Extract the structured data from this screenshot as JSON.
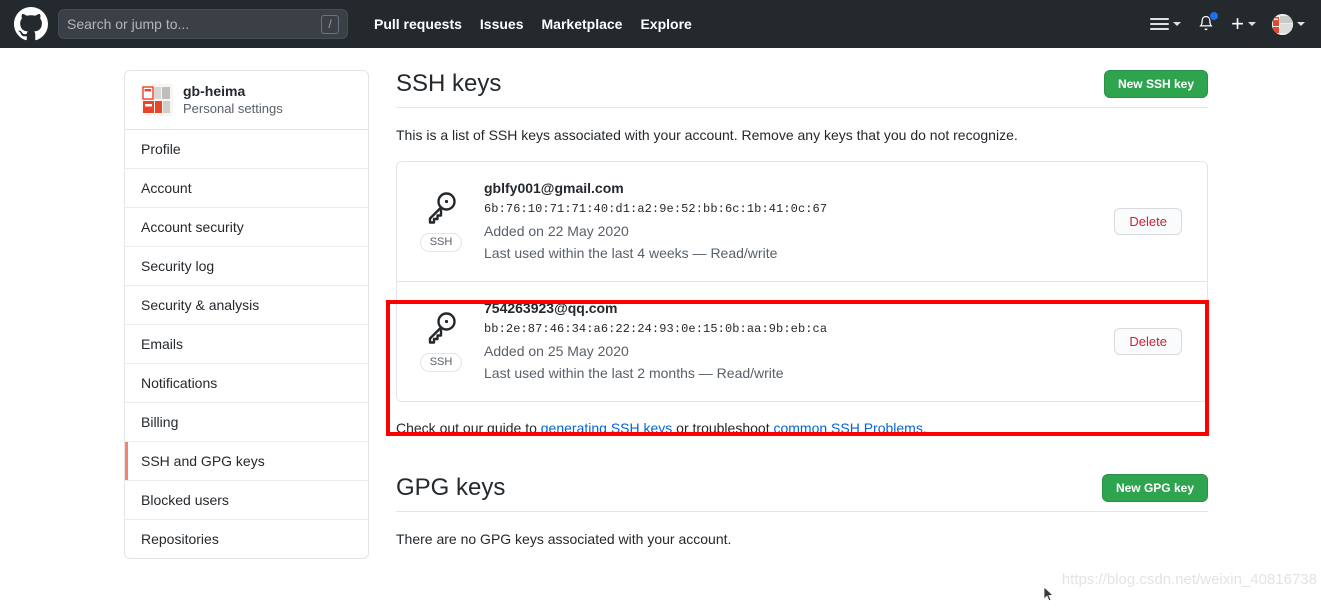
{
  "header": {
    "logo_icon": "github-mark-icon",
    "search": {
      "placeholder": "Search or jump to...",
      "value": "",
      "shortcut_key": "/"
    },
    "nav": [
      {
        "label": "Pull requests"
      },
      {
        "label": "Issues"
      },
      {
        "label": "Marketplace"
      },
      {
        "label": "Explore"
      }
    ],
    "right": {
      "menu_icon": "hamburger-icon",
      "notifications_icon": "bell-icon",
      "notifications_unread": true,
      "create_new_icon": "plus-icon",
      "avatar_icon": "user-avatar"
    },
    "background_color": "#24292e"
  },
  "sidebar": {
    "user": {
      "name": "gb-heima",
      "subtitle": "Personal settings",
      "avatar_icon": "user-avatar"
    },
    "items": [
      {
        "label": "Profile",
        "selected": false
      },
      {
        "label": "Account",
        "selected": false
      },
      {
        "label": "Account security",
        "selected": false
      },
      {
        "label": "Security log",
        "selected": false
      },
      {
        "label": "Security & analysis",
        "selected": false
      },
      {
        "label": "Emails",
        "selected": false
      },
      {
        "label": "Notifications",
        "selected": false
      },
      {
        "label": "Billing",
        "selected": false
      },
      {
        "label": "SSH and GPG keys",
        "selected": true
      },
      {
        "label": "Blocked users",
        "selected": false
      },
      {
        "label": "Repositories",
        "selected": false
      }
    ],
    "selected_accent_color": "#f9826c"
  },
  "main": {
    "ssh": {
      "title": "SSH keys",
      "new_button": "New SSH key",
      "description": "This is a list of SSH keys associated with your account. Remove any keys that you do not recognize.",
      "keys": [
        {
          "title": "gblfy001@gmail.com",
          "fingerprint": "6b:76:10:71:71:40:d1:a2:9e:52:bb:6c:1b:41:0c:67",
          "added": "Added on 22 May 2020",
          "last_used": "Last used within the last 4 weeks — Read/write",
          "badge": "SSH",
          "delete_label": "Delete",
          "highlighted": false
        },
        {
          "title": "754263923@qq.com",
          "fingerprint": "bb:2e:87:46:34:a6:22:24:93:0e:15:0b:aa:9b:eb:ca",
          "added": "Added on 25 May 2020",
          "last_used": "Last used within the last 2 months — Read/write",
          "badge": "SSH",
          "delete_label": "Delete",
          "highlighted": true
        }
      ],
      "help": {
        "prefix": "Check out our guide to ",
        "link1": "generating SSH keys",
        "middle": " or troubleshoot ",
        "link2": "common SSH Problems",
        "suffix": "."
      }
    },
    "gpg": {
      "title": "GPG keys",
      "new_button": "New GPG key",
      "description": "There are no GPG keys associated with your account."
    }
  },
  "annotations": {
    "highlight_color": "#ff0000",
    "watermark": "https://blog.csdn.net/weixin_40816738"
  },
  "colors": {
    "green_button": "#2ea44f",
    "link_blue": "#0366d6",
    "delete_red": "#cb2431"
  }
}
